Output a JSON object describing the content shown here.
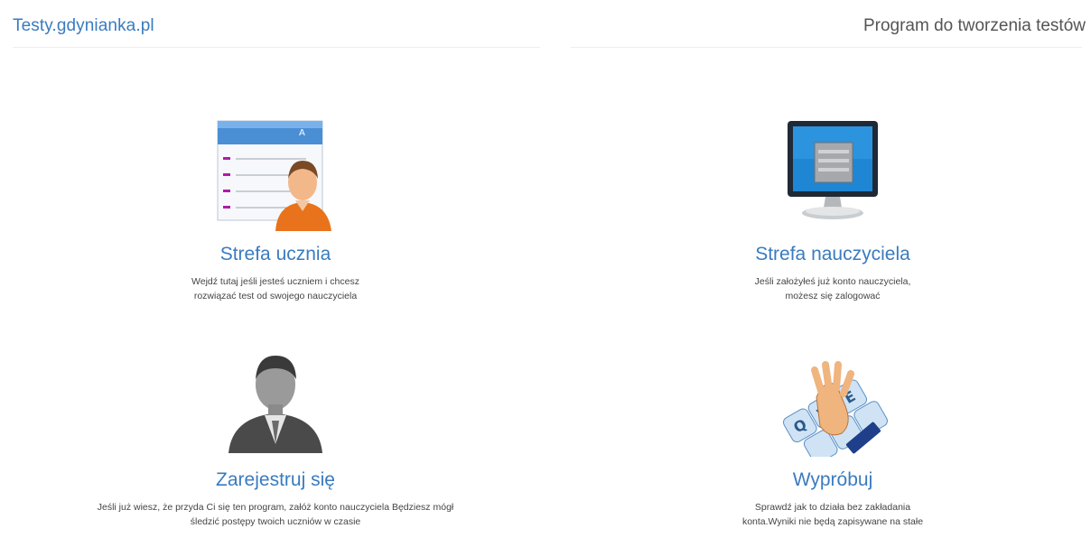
{
  "header": {
    "brand": "Testy.gdynianka.pl",
    "tagline": "Program do tworzenia testów"
  },
  "tiles": [
    {
      "icon": "student-list-icon",
      "title": "Strefa ucznia",
      "desc": [
        "Wejdź tutaj jeśli jesteś uczniem i chcesz",
        "rozwiązać test od swojego nauczyciela"
      ]
    },
    {
      "icon": "monitor-icon",
      "title": "Strefa nauczyciela",
      "desc": [
        "Jeśli założyłeś już konto nauczyciela,",
        "możesz się zalogować"
      ]
    },
    {
      "icon": "user-silhouette-icon",
      "title": "Zarejestruj się",
      "desc": [
        "Jeśli już wiesz, że przyda Ci się ten program, załóż konto nauczyciela Będziesz mógł",
        "śledzić postępy twoich uczniów w czasie"
      ]
    },
    {
      "icon": "keyboard-hand-icon",
      "title": "Wypróbuj",
      "desc": [
        "Sprawdź jak to działa bez zakładania",
        "konta.Wyniki nie będą zapisywane na stałe"
      ]
    }
  ],
  "colors": {
    "link": "#3a7bbf",
    "accent_orange": "#e8731c",
    "purple_marker": "#b01aa8"
  }
}
